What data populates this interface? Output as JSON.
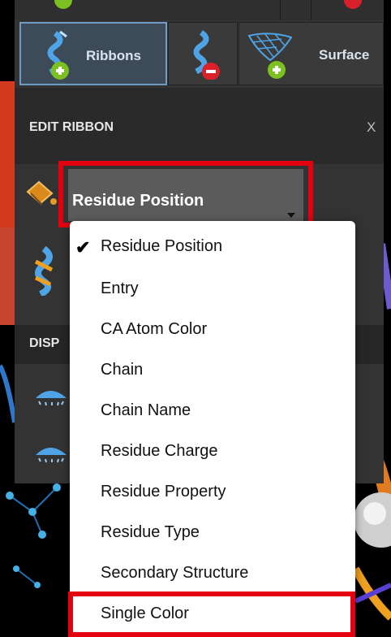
{
  "colors": {
    "panel_bg": "#2b2b2b",
    "accent_blue": "#6f9cc4",
    "highlight_red": "#e3000f",
    "add_green": "#7cc11f",
    "remove_red": "#d9202b",
    "menu_bg": "#ffffff"
  },
  "toolbar": {
    "buttons": [
      {
        "label": "Ribbons",
        "icon": "ribbon-add-icon",
        "active": true
      },
      {
        "label": "",
        "icon": "ribbon-remove-icon",
        "active": false
      },
      {
        "label": "Surface",
        "icon": "surface-add-icon",
        "active": false
      }
    ]
  },
  "edit_ribbon": {
    "title": "EDIT RIBBON",
    "close_label": "X",
    "color_scheme_icon": "paint-bucket-icon",
    "style_icon": "ribbon-style-icon",
    "selected": "Residue Position"
  },
  "display": {
    "title_visible": "DISP"
  },
  "dropdown": {
    "checkmark": "✔",
    "options": [
      "Residue Position",
      "Entry",
      "CA Atom Color",
      "Chain",
      "Chain Name",
      "Residue Charge",
      "Residue Property",
      "Residue Type",
      "Secondary Structure",
      "Single Color"
    ],
    "selected_index": 0,
    "highlighted_option": "Single Color"
  }
}
